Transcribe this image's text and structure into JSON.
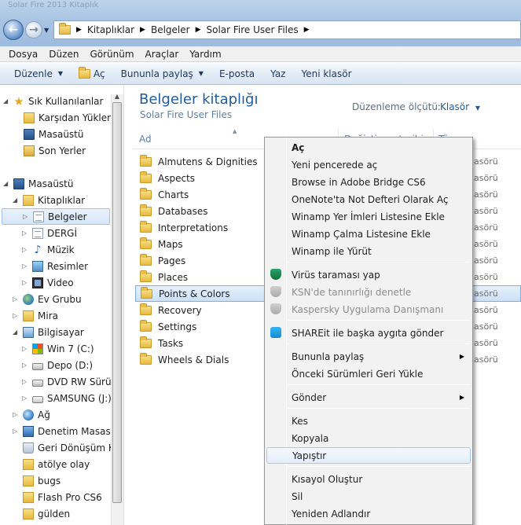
{
  "window": {
    "title_blur": "Solar Fire 2013   Kitaplık"
  },
  "address": {
    "crumbs": [
      "Kitaplıklar",
      "Belgeler",
      "Solar Fire User Files"
    ]
  },
  "menubar": [
    "Dosya",
    "Düzen",
    "Görünüm",
    "Araçlar",
    "Yardım"
  ],
  "toolbar": {
    "organize": "Düzenle",
    "open": "Aç",
    "share": "Bununla paylaş",
    "email": "E-posta",
    "print": "Yaz",
    "new_folder": "Yeni klasör"
  },
  "nav": {
    "favorites": "Sık Kullanılanlar",
    "downloads": "Karşıdan Yüklem",
    "desktop_fav": "Masaüstü",
    "recent": "Son Yerler",
    "desktop": "Masaüstü",
    "libraries": "Kitaplıklar",
    "documents": "Belgeler",
    "dergi": "DERGİ",
    "music": "Müzik",
    "pictures": "Resimler",
    "video": "Video",
    "homegroup": "Ev Grubu",
    "mira": "Mira",
    "computer": "Bilgisayar",
    "drive_c": "Win 7 (C:)",
    "drive_d": "Depo (D:)",
    "drive_dvd": "DVD RW Sürücü",
    "drive_j": "SAMSUNG (J:)",
    "network": "Ağ",
    "control": "Denetim Masası",
    "recycle": "Geri Dönüşüm Ku",
    "atolye": "atölye olay",
    "bugs": "bugs",
    "flash": "Flash Pro CS6",
    "gulden": "gülden"
  },
  "library": {
    "title": "Belgeler kitaplığı",
    "subtitle": "Solar Fire User Files",
    "arrange_label": "Düzenleme ölçütü:",
    "arrange_value": "Klasör",
    "col_name": "Ad",
    "col_date": "Değiştirme tarihi",
    "col_type": "Tür"
  },
  "files": [
    "Almutens & Dignities",
    "Aspects",
    "Charts",
    "Databases",
    "Interpretations",
    "Maps",
    "Pages",
    "Places",
    "Points & Colors",
    "Recovery",
    "Settings",
    "Tasks",
    "Wheels & Dials"
  ],
  "type_fragment": "lasörü",
  "context_menu": {
    "open": "Aç",
    "open_new": "Yeni pencerede aç",
    "bridge": "Browse in Adobe Bridge CS6",
    "onenote": "OneNote'ta Not Defteri Olarak Aç",
    "winamp_bookmarks": "Winamp Yer İmleri Listesine Ekle",
    "winamp_playlist": "Winamp Çalma Listesine Ekle",
    "winamp_play": "Winamp ile Yürüt",
    "virus_scan": "Virüs taraması yap",
    "ksn": "KSN'de tanınırlığı denetle",
    "kaspersky": "Kaspersky Uygulama Danışmanı",
    "shareit": "SHAREit ile başka aygıta gönder",
    "share_with": "Bununla paylaş",
    "restore": "Önceki Sürümleri Geri Yükle",
    "send_to": "Gönder",
    "cut": "Kes",
    "copy": "Kopyala",
    "paste": "Yapıştır",
    "shortcut": "Kısayol Oluştur",
    "delete": "Sil",
    "rename": "Yeniden Adlandır"
  },
  "colors": {
    "title_blue": "#1e5c9e",
    "selection": "#cce1f7",
    "shield_green": "#12703f"
  }
}
